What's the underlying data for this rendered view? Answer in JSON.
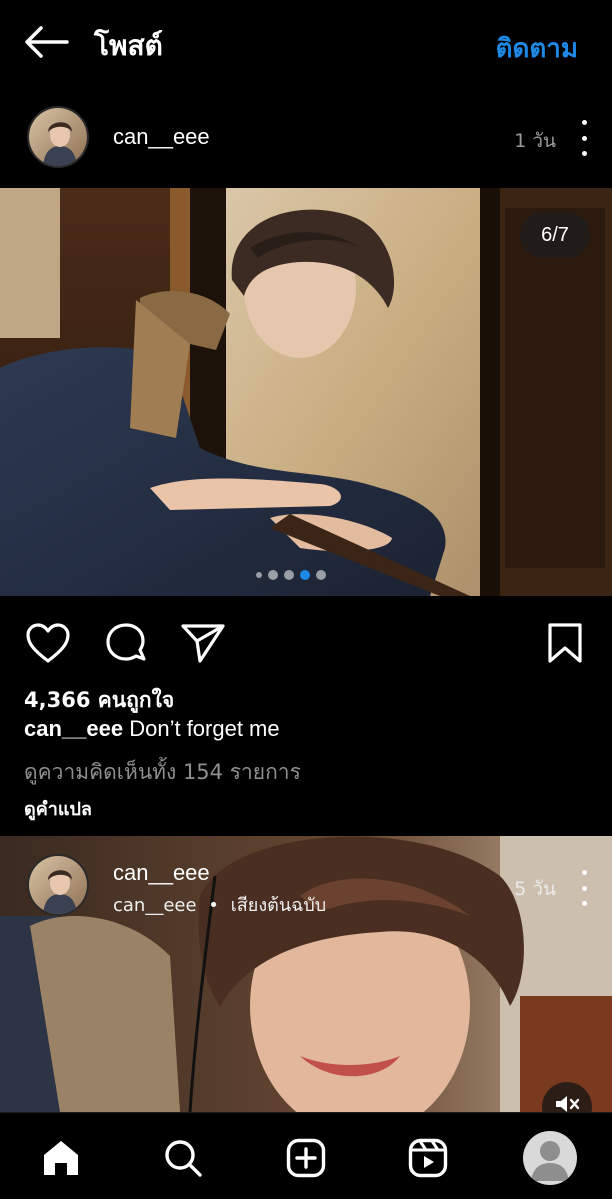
{
  "header": {
    "title": "โพสต์",
    "follow_label": "ติดตาม"
  },
  "post": {
    "username": "can__eee",
    "time_ago": "1 วัน",
    "photo_counter": "6/7",
    "current_photo": 6,
    "total_photos": 7,
    "likes": "4,366 คนถูกใจ",
    "caption_user": "can__eee",
    "caption_text": "Don’t forget me",
    "view_comments": "ดูความคิดเห็นทั้ง 154 รายการ",
    "see_translation": "ดูคำแปล"
  },
  "post2": {
    "username": "can__eee",
    "audio_user": "can__eee",
    "audio_label": "เสียงต้นฉบับ",
    "separator": "•",
    "time_ago": "5 วัน"
  },
  "icons": {
    "back": "arrow-left-icon",
    "more": "more-vertical-icon",
    "like": "heart-icon",
    "comment": "comment-icon",
    "share": "send-icon",
    "save": "bookmark-icon",
    "mute": "speaker-muted-icon",
    "home": "home-icon",
    "search": "search-icon",
    "create": "plus-square-icon",
    "reels": "reels-icon",
    "profile": "profile-avatar"
  },
  "colors": {
    "accent": "#1e88e5",
    "background": "#000000",
    "text": "#ffffff",
    "muted_text": "#8f8f8f"
  }
}
